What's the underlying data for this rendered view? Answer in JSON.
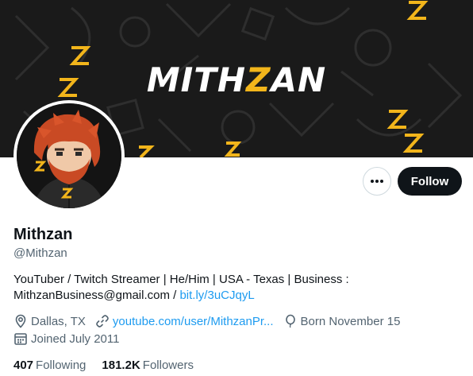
{
  "banner": {
    "title_main": "MITH",
    "title_highlight": "Z",
    "title_end": "AN"
  },
  "profile": {
    "name": "Mithzan",
    "handle": "@Mithzan",
    "bio_text": "YouTuber / Twitch Streamer | He/Him | USA - Texas | Business : MithzanBusiness@gmail.com / ",
    "bio_link": "bit.ly/3uCJqyL",
    "location": "Dallas, TX",
    "website": "youtube.com/user/MithzanPr...",
    "born": "Born November 15",
    "joined": "Joined July 2011",
    "following_count": "407",
    "following_label": "Following",
    "followers_count": "181.2K",
    "followers_label": "Followers"
  },
  "actions": {
    "follow_label": "Follow",
    "more_icon": "ellipsis-icon"
  },
  "colors": {
    "accent": "#1d9bf0",
    "text": "#0f1419",
    "muted": "#536471",
    "brand_yellow": "#f2b51b"
  }
}
